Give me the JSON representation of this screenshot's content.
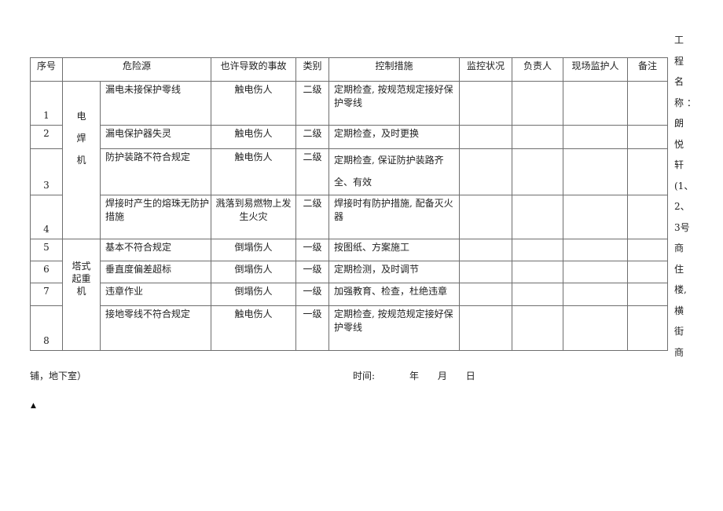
{
  "table": {
    "headers": {
      "seq": "序号",
      "hazard_source": "危险源",
      "possible_accident": "也许导致的事故",
      "category": "类别",
      "control_measures": "控制措施",
      "monitoring_status": "监控状况",
      "responsible": "负责人",
      "site_supervisor": "现场监护人",
      "remarks": "备注"
    },
    "groups": [
      {
        "name": "电焊机",
        "chars": [
          "电",
          "焊",
          "机"
        ]
      },
      {
        "name": "塔式起重机",
        "lines": [
          "塔式",
          "起重",
          "机"
        ]
      }
    ],
    "rows": [
      {
        "seq": "1",
        "hazard": "漏电未接保护零线",
        "accident": "触电伤人",
        "level": "二级",
        "control": "定期检查, 按规范规定接好保护零线",
        "monitoring": "",
        "responsible": "",
        "supervisor": "",
        "remarks": ""
      },
      {
        "seq": "2",
        "hazard": "漏电保护器失灵",
        "accident": "触电伤人",
        "level": "二级",
        "control": "定期检查，及时更换",
        "monitoring": "",
        "responsible": "",
        "supervisor": "",
        "remarks": ""
      },
      {
        "seq": "3",
        "hazard": "防护装路不符合规定",
        "accident": "触电伤人",
        "level": "二级",
        "control": "定期检查, 保证防护装路齐全、有效",
        "monitoring": "",
        "responsible": "",
        "supervisor": "",
        "remarks": ""
      },
      {
        "seq": "4",
        "hazard": "焊接时产生的熔珠无防护措施",
        "accident": "溅落到易燃物上发生火灾",
        "level": "二级",
        "control": "焊接时有防护措施, 配备灭火器",
        "monitoring": "",
        "responsible": "",
        "supervisor": "",
        "remarks": ""
      },
      {
        "seq": "5",
        "hazard": "基本不符合规定",
        "accident": "倒塌伤人",
        "level": "一级",
        "control": "按图纸、方案施工",
        "monitoring": "",
        "responsible": "",
        "supervisor": "",
        "remarks": ""
      },
      {
        "seq": "6",
        "hazard": "垂直度偏差超标",
        "accident": "倒塌伤人",
        "level": "一级",
        "control": "定期检测，及时调节",
        "monitoring": "",
        "responsible": "",
        "supervisor": "",
        "remarks": ""
      },
      {
        "seq": "7",
        "hazard": "违章作业",
        "accident": "倒塌伤人",
        "level": "一级",
        "control": "加强教育、检查，杜绝违章",
        "monitoring": "",
        "responsible": "",
        "supervisor": "",
        "remarks": ""
      },
      {
        "seq": "8",
        "hazard": "接地零线不符合规定",
        "accident": "触电伤人",
        "level": "一级",
        "control": "定期检查, 按规范规定接好保护零线",
        "monitoring": "",
        "responsible": "",
        "supervisor": "",
        "remarks": ""
      }
    ]
  },
  "side_title": {
    "full": "工程名称：朗悦轩(1、2、3号商住楼,横街商",
    "chars": [
      "工",
      "程",
      "名",
      "称 ：",
      "朗",
      "悦",
      "轩",
      "(1、",
      "2、",
      "3号",
      "商",
      "住",
      "楼,",
      "横",
      "街",
      "商"
    ]
  },
  "footer": {
    "project_continuation": "铺，地下室）",
    "time_label": "时间:",
    "year": "年",
    "month": "月",
    "day": "日",
    "mark_icon": "small-mark-icon"
  }
}
